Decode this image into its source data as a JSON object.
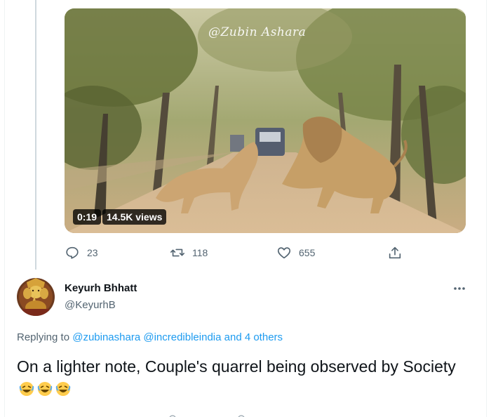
{
  "media": {
    "watermark": "@Zubin Ashara",
    "duration": "0:19",
    "views": "14.5K views",
    "alt": "Two lions fighting on a forest road with a safari jeep in the background"
  },
  "actions": {
    "reply_count": "23",
    "retweet_count": "118",
    "like_count": "655"
  },
  "reply_tweet": {
    "display_name": "Keyurh Bhhatt",
    "handle": "@KeyurhB",
    "replying_prefix": "Replying to",
    "replying_to": [
      "@zubinashara",
      "@incredibleindia"
    ],
    "replying_suffix": "and 4 others",
    "text": "On a lighter note,  Couple's quarrel being observed by Society",
    "emoji": [
      "rofl-emoji",
      "rofl-emoji",
      "rofl-emoji"
    ]
  },
  "colors": {
    "accent": "#1d9bf0",
    "secondary_text": "#536471",
    "primary_text": "#0f1419"
  }
}
